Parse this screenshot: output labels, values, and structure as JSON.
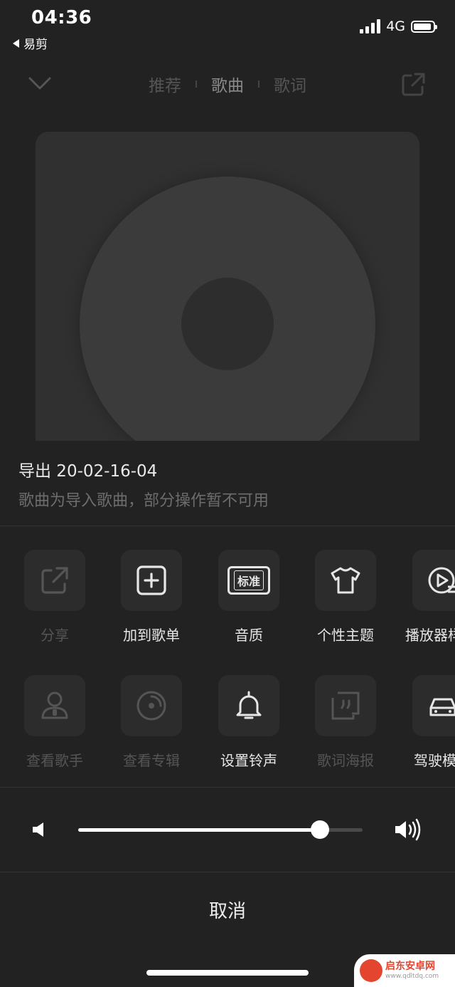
{
  "status": {
    "time": "04:36",
    "back_label": "易剪",
    "network": "4G"
  },
  "nav": {
    "tabs": [
      "推荐",
      "歌曲",
      "歌词"
    ],
    "active_tab": "歌曲"
  },
  "song": {
    "title": "导出 20-02-16-04",
    "subtitle": "歌曲为导入歌曲，部分操作暂不可用"
  },
  "actions_row1": [
    {
      "label": "分享",
      "icon": "share-icon",
      "enabled": false
    },
    {
      "label": "加到歌单",
      "icon": "add-to-playlist-icon",
      "enabled": true
    },
    {
      "label": "音质",
      "icon": "quality-icon",
      "badge": "标准",
      "enabled": true
    },
    {
      "label": "个性主题",
      "icon": "tshirt-icon",
      "enabled": true
    },
    {
      "label": "播放器样式",
      "icon": "player-style-icon",
      "enabled": true
    }
  ],
  "actions_row2": [
    {
      "label": "查看歌手",
      "icon": "singer-icon",
      "enabled": false
    },
    {
      "label": "查看专辑",
      "icon": "album-icon",
      "enabled": false
    },
    {
      "label": "设置铃声",
      "icon": "bell-icon",
      "enabled": true
    },
    {
      "label": "歌词海报",
      "icon": "lyrics-poster-icon",
      "enabled": false
    },
    {
      "label": "驾驶模式",
      "icon": "car-icon",
      "enabled": true
    }
  ],
  "volume": {
    "level": 0.85
  },
  "cancel_label": "取消",
  "watermark": {
    "main": "启东安卓网",
    "sub": "www.qdltdq.com"
  },
  "colors": {
    "background": "#222222",
    "tile": "#2c2c2c",
    "active_text": "#e6e6e6",
    "disabled_text": "#555555"
  }
}
